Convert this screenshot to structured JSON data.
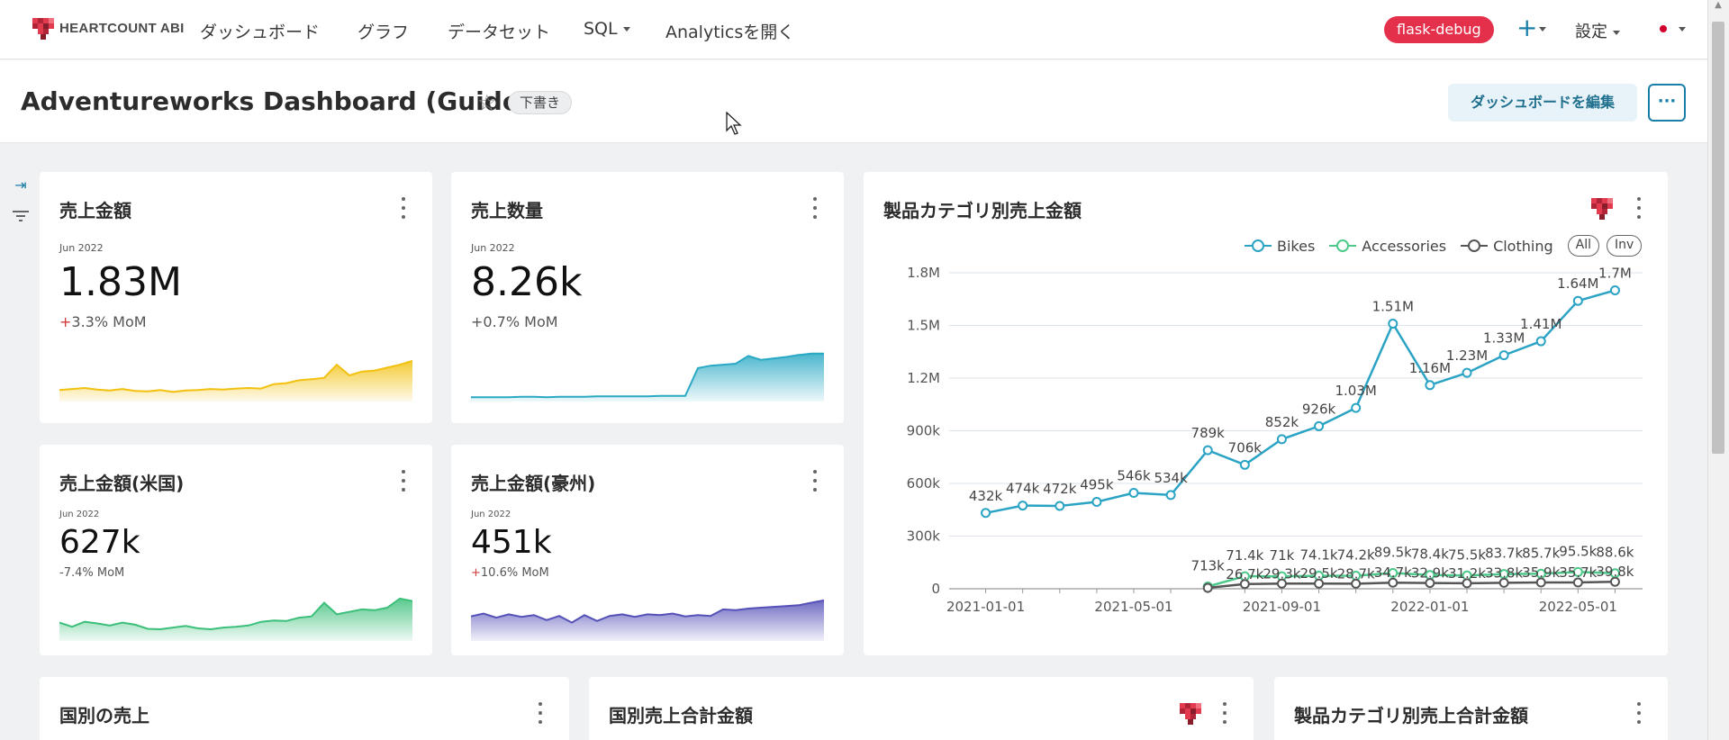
{
  "nav": {
    "logo_text": "HEARTCOUNT ABI",
    "items": [
      "ダッシュボード",
      "グラフ",
      "データセット",
      "SQL",
      "Analyticsを開く"
    ],
    "user_badge": "flask-debug",
    "plus_label": "+",
    "settings_label": "設定"
  },
  "header": {
    "title": "Adventureworks Dashboard (Guide)",
    "draft_badge": "下書き",
    "edit_button": "ダッシュボードを編集",
    "more_button": "···"
  },
  "kpis": [
    {
      "title": "売上金額",
      "period": "Jun 2022",
      "value": "1.83M",
      "change_sign": "+",
      "change": "3.3% MoM",
      "color": "#f2c10f",
      "spark": [
        0.2,
        0.22,
        0.24,
        0.21,
        0.19,
        0.22,
        0.18,
        0.17,
        0.2,
        0.16,
        0.19,
        0.2,
        0.22,
        0.21,
        0.23,
        0.24,
        0.23,
        0.32,
        0.34,
        0.4,
        0.42,
        0.45,
        0.72,
        0.5,
        0.58,
        0.6,
        0.66,
        0.72,
        0.8
      ]
    },
    {
      "title": "売上数量",
      "period": "Jun 2022",
      "value": "8.26k",
      "change_sign": "+",
      "change": "0.7% MoM",
      "color": "#2aa9c4",
      "spark": [
        0.05,
        0.05,
        0.05,
        0.05,
        0.06,
        0.06,
        0.05,
        0.06,
        0.06,
        0.06,
        0.07,
        0.07,
        0.07,
        0.07,
        0.07,
        0.08,
        0.08,
        0.08,
        0.65,
        0.7,
        0.72,
        0.74,
        0.9,
        0.82,
        0.85,
        0.88,
        0.92,
        0.95,
        0.95
      ]
    },
    {
      "title": "売上金額(米国)",
      "period": "Jun 2022",
      "value": "627k",
      "change_sign": "-",
      "change": "7.4% MoM",
      "color": "#3cbf7a",
      "spark": [
        0.4,
        0.3,
        0.42,
        0.38,
        0.33,
        0.4,
        0.35,
        0.25,
        0.24,
        0.28,
        0.32,
        0.26,
        0.24,
        0.28,
        0.3,
        0.33,
        0.42,
        0.45,
        0.44,
        0.52,
        0.55,
        0.88,
        0.6,
        0.66,
        0.72,
        0.7,
        0.76,
        0.98,
        0.92
      ]
    },
    {
      "title": "売上金額(豪州)",
      "period": "Jun 2022",
      "value": "451k",
      "change_sign": "+",
      "change": "10.6% MoM",
      "color": "#5551b8",
      "spark": [
        0.55,
        0.62,
        0.52,
        0.6,
        0.54,
        0.58,
        0.46,
        0.56,
        0.4,
        0.58,
        0.44,
        0.56,
        0.6,
        0.54,
        0.6,
        0.58,
        0.62,
        0.55,
        0.58,
        0.56,
        0.72,
        0.7,
        0.74,
        0.76,
        0.78,
        0.8,
        0.82,
        0.88,
        0.94
      ]
    }
  ],
  "line_chart": {
    "title": "製品カテゴリ別売上金額",
    "legend_pills": [
      "All",
      "Inv"
    ]
  },
  "chart_data": {
    "type": "line",
    "title": "製品カテゴリ別売上金額",
    "x_ticks": [
      "2021-01-01",
      "2021-05-01",
      "2021-09-01",
      "2022-01-01",
      "2022-05-01"
    ],
    "y_ticks": [
      "0",
      "300k",
      "600k",
      "900k",
      "1.2M",
      "1.5M",
      "1.8M"
    ],
    "ylim": [
      0,
      1800000
    ],
    "legend_placement": "top-right",
    "grid": true,
    "months": [
      "2020-12",
      "2021-01",
      "2021-02",
      "2021-03",
      "2021-04",
      "2021-05",
      "2021-06",
      "2021-07",
      "2021-08",
      "2021-09",
      "2021-10",
      "2021-11",
      "2021-12",
      "2022-01",
      "2022-02",
      "2022-03",
      "2022-04",
      "2022-05",
      "2022-06"
    ],
    "series": [
      {
        "name": "Bikes",
        "color": "#2aa3c4",
        "values": [
          432000,
          474000,
          472000,
          495000,
          546000,
          534000,
          789000,
          706000,
          852000,
          926000,
          1030000,
          1510000,
          1160000,
          1230000,
          1330000,
          1410000,
          1640000,
          1700000
        ],
        "start_index": 1,
        "labels": [
          "432k",
          "474k",
          "472k",
          "495k",
          "546k",
          "534k",
          "789k",
          "706k",
          "852k",
          "926k",
          "1.03M",
          "1.51M",
          "1.16M",
          "1.23M",
          "1.33M",
          "1.41M",
          "1.64M",
          "1.7M"
        ]
      },
      {
        "name": "Accessories",
        "color": "#4cc98a",
        "values": [
          13000,
          71400,
          71000,
          74100,
          74200,
          89500,
          78400,
          75500,
          83700,
          85700,
          95500,
          88600
        ],
        "start_index": 7,
        "labels": [
          "713k",
          "71.4k",
          "71k",
          "74.1k",
          "74.2k",
          "89.5k",
          "78.4k",
          "75.5k",
          "83.7k",
          "85.7k",
          "95.5k",
          "88.6k"
        ]
      },
      {
        "name": "Clothing",
        "color": "#555555",
        "values": [
          5000,
          26700,
          29300,
          29500,
          28700,
          34700,
          32900,
          31200,
          33800,
          35900,
          35700,
          39800
        ],
        "start_index": 7,
        "labels": [
          "",
          "26.7k",
          "29.3k",
          "29.5k",
          "28.7k",
          "34.7k",
          "32.9k",
          "31.2k",
          "33.8k",
          "35.9k",
          "35.7k",
          "39.8k"
        ]
      }
    ]
  },
  "bottom_cards": [
    {
      "title": "国別の売上"
    },
    {
      "title": "国別売上合計金額"
    },
    {
      "title": "製品カテゴリ別売上合計金額"
    }
  ],
  "icons": {
    "star": "☆",
    "collapse": "⇥",
    "filter": "≡"
  }
}
